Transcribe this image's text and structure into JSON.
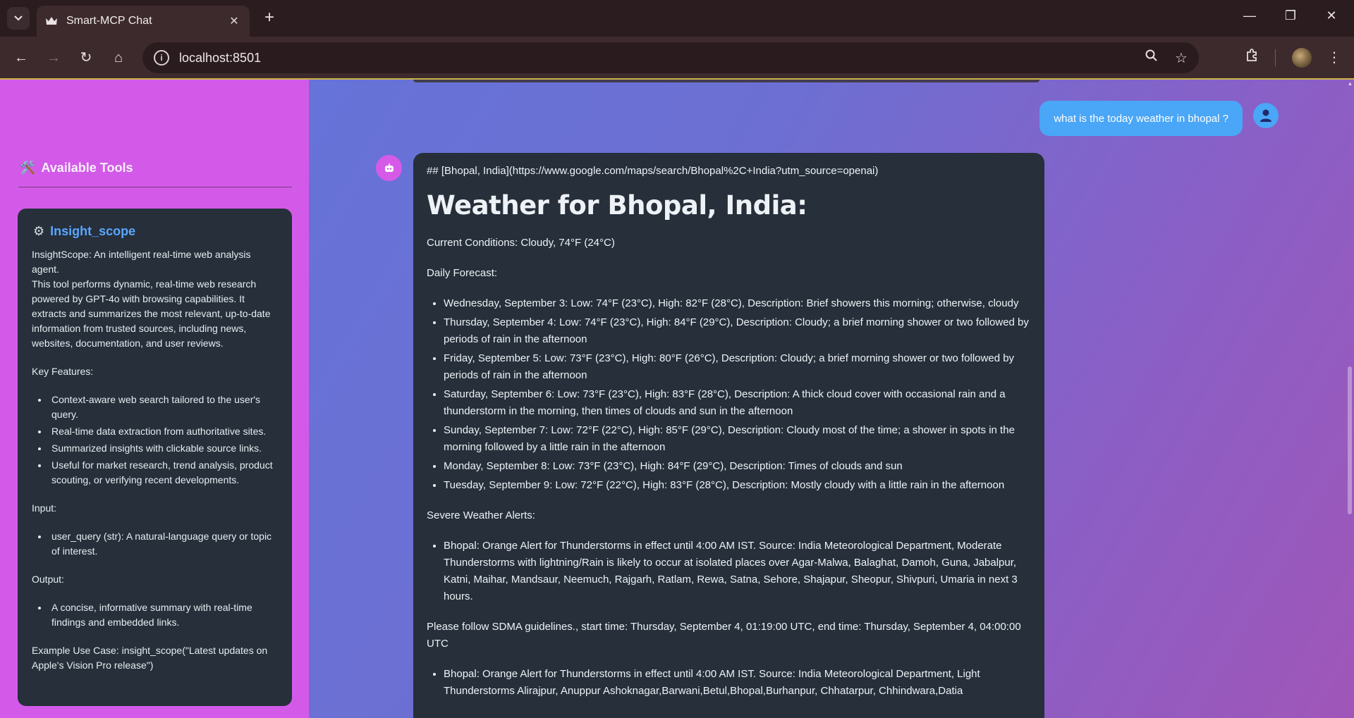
{
  "browser": {
    "tab_title": "Smart-MCP Chat",
    "url": "localhost:8501",
    "icons": [
      "tab-search-icon",
      "crown-favicon",
      "close-icon",
      "plus-icon",
      "minimize-icon",
      "restore-icon",
      "window-close-icon",
      "back-icon",
      "forward-icon",
      "reload-icon",
      "home-icon",
      "info-icon",
      "zoom-icon",
      "star-icon",
      "extensions-icon",
      "profile-avatar",
      "menu-icon"
    ]
  },
  "sidebar": {
    "heading_icon": "🛠️",
    "heading": "Available Tools",
    "tool": {
      "name": "Insight_scope",
      "description_1": "InsightScope: An intelligent real-time web analysis agent.",
      "description_2": "This tool performs dynamic, real-time web research powered by GPT-4o with browsing capabilities. It extracts and summarizes the most relevant, up-to-date information from trusted sources, including news, websites, documentation, and user reviews.",
      "features_title": "Key Features:",
      "features": [
        "Context-aware web search tailored to the user's query.",
        "Real-time data extraction from authoritative sites.",
        "Summarized insights with clickable source links.",
        "Useful for market research, trend analysis, product scouting, or verifying recent developments."
      ],
      "input_title": "Input:",
      "inputs": [
        "user_query (str): A natural-language query or topic of interest."
      ],
      "output_title": "Output:",
      "outputs": [
        "A concise, informative summary with real-time findings and embedded links."
      ],
      "example": "Example Use Case: insight_scope(\"Latest updates on Apple's Vision Pro release\")"
    }
  },
  "chat": {
    "user_message": "what is the today weather in bhopal ?",
    "bot": {
      "md_link": "## [Bhopal, India](https://www.google.com/maps/search/Bhopal%2C+India?utm_source=openai)",
      "heading": "Weather for Bhopal, India:",
      "current": "Current Conditions: Cloudy, 74°F (24°C)",
      "forecast_title": "Daily Forecast:",
      "forecast": [
        "Wednesday, September 3: Low: 74°F (23°C), High: 82°F (28°C), Description: Brief showers this morning; otherwise, cloudy",
        "Thursday, September 4: Low: 74°F (23°C), High: 84°F (29°C), Description: Cloudy; a brief morning shower or two followed by periods of rain in the afternoon",
        "Friday, September 5: Low: 73°F (23°C), High: 80°F (26°C), Description: Cloudy; a brief morning shower or two followed by periods of rain in the afternoon",
        "Saturday, September 6: Low: 73°F (23°C), High: 83°F (28°C), Description: A thick cloud cover with occasional rain and a thunderstorm in the morning, then times of clouds and sun in the afternoon",
        "Sunday, September 7: Low: 72°F (22°C), High: 85°F (29°C), Description: Cloudy most of the time; a shower in spots in the morning followed by a little rain in the afternoon",
        "Monday, September 8: Low: 73°F (23°C), High: 84°F (29°C), Description: Times of clouds and sun",
        "Tuesday, September 9: Low: 72°F (22°C), High: 83°F (28°C), Description: Mostly cloudy with a little rain in the afternoon"
      ],
      "alerts_title": "Severe Weather Alerts:",
      "alert_1": "Bhopal: Orange Alert for Thunderstorms in effect until 4:00 AM IST. Source: India Meteorological Department, Moderate Thunderstorms with lightning/Rain is likely to occur at isolated places over Agar-Malwa, Balaghat, Damoh, Guna, Jabalpur, Katni, Maihar, Mandsaur, Neemuch, Rajgarh, Ratlam, Rewa, Satna, Sehore, Shajapur, Sheopur, Shivpuri, Umaria in next 3 hours.",
      "sdma": "Please follow SDMA guidelines., start time: Thursday, September 4, 01:19:00 UTC, end time: Thursday, September 4, 04:00:00 UTC",
      "alert_2": "Bhopal: Orange Alert for Thunderstorms in effect until 4:00 AM IST. Source: India Meteorological Department, Light Thunderstorms Alirajpur, Anuppur Ashoknagar,Barwani,Betul,Bhopal,Burhanpur, Chhatarpur, Chhindwara,Datia"
    }
  },
  "colors": {
    "sidebar_bg": "#d35ae8",
    "card_bg": "#262f3a",
    "user_bubble": "#4aa6f6",
    "tool_name": "#5aa6ff"
  }
}
